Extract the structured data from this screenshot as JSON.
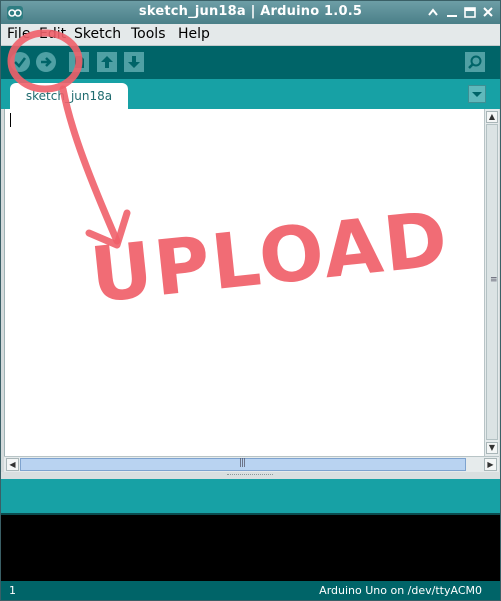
{
  "window": {
    "title": "sketch_jun18a | Arduino 1.0.5"
  },
  "menubar": {
    "items": [
      {
        "label": "File"
      },
      {
        "label": "Edit"
      },
      {
        "label": "Sketch"
      },
      {
        "label": "Tools"
      },
      {
        "label": "Help"
      }
    ]
  },
  "toolbar": {
    "buttons": [
      {
        "icon": "verify-icon"
      },
      {
        "icon": "upload-icon"
      },
      {
        "icon": "new-icon"
      },
      {
        "icon": "open-icon"
      },
      {
        "icon": "save-icon"
      },
      {
        "icon": "serial-monitor-icon"
      }
    ]
  },
  "tabs": [
    {
      "label": "sketch_jun18a"
    }
  ],
  "editor": {
    "content": ""
  },
  "annotation": {
    "text": "UPLOAD",
    "color": "#f0606a"
  },
  "footer": {
    "line_number": "1",
    "board": "Arduino Uno on /dev/ttyACM0"
  },
  "colors": {
    "toolbar": "#006468",
    "tabstrip": "#17a1a5",
    "annotation": "#f0606a"
  }
}
